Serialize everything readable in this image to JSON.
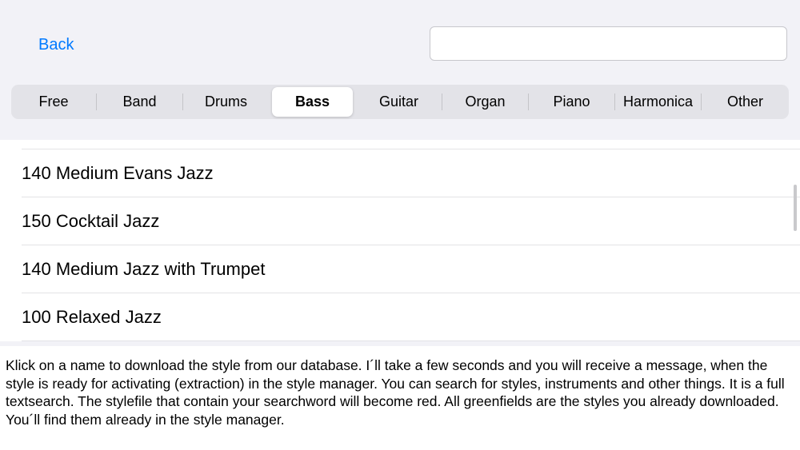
{
  "header": {
    "back_label": "Back",
    "search": {
      "value": "",
      "placeholder": ""
    }
  },
  "tabs": [
    {
      "label": "Free",
      "selected": false
    },
    {
      "label": "Band",
      "selected": false
    },
    {
      "label": "Drums",
      "selected": false
    },
    {
      "label": "Bass",
      "selected": true
    },
    {
      "label": "Guitar",
      "selected": false
    },
    {
      "label": "Organ",
      "selected": false
    },
    {
      "label": "Piano",
      "selected": false
    },
    {
      "label": "Harmonica",
      "selected": false
    },
    {
      "label": "Other",
      "selected": false
    }
  ],
  "list": {
    "items": [
      "140 Medium Evans Jazz",
      "150 Cocktail Jazz",
      "140 Medium Jazz with Trumpet",
      "100 Relaxed Jazz"
    ]
  },
  "info": {
    "text": "Klick on a name to download the style from our database.  I´ll take a few seconds and you will receive a message, when the style is ready for activating (extraction) in the style manager. You can search for styles, instruments and other things. It is a full textsearch. The stylefile that contain your searchword will become red. All greenfields are the styles you already downloaded. You´ll find them already in the style manager."
  },
  "colors": {
    "accent": "#007aff",
    "header_background": "#f2f2f7",
    "segment_background": "#e3e3e8"
  }
}
